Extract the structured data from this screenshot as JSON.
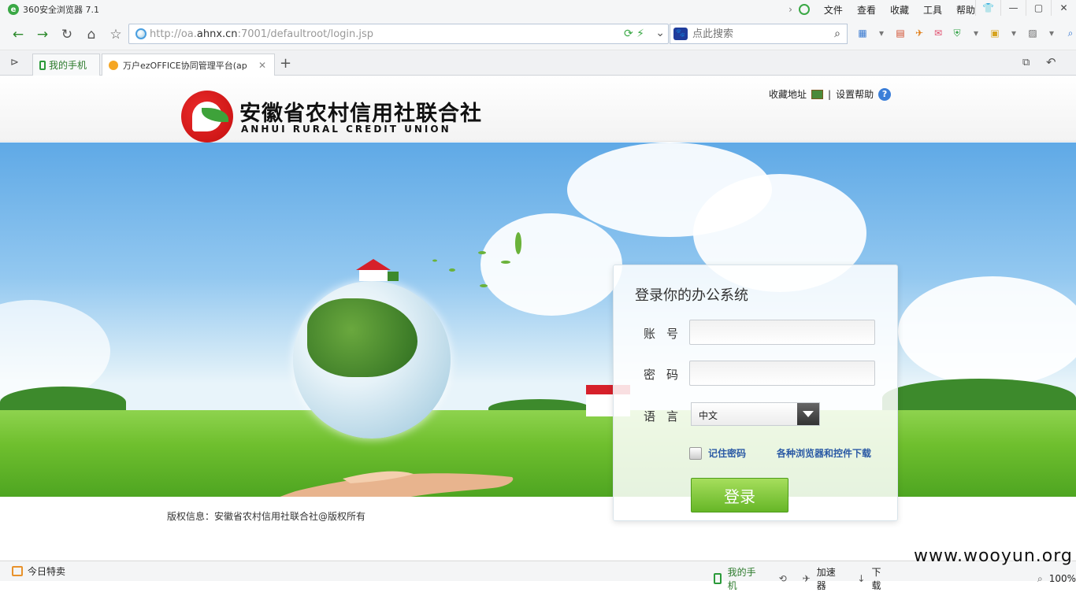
{
  "browser": {
    "title": "360安全浏览器 7.1",
    "menu": [
      "文件",
      "查看",
      "收藏",
      "工具",
      "帮助"
    ],
    "url_prefix": "http://oa.",
    "url_domain": "ahnx.cn",
    "url_rest": ":7001/defaultroot/login.jsp",
    "search_placeholder": "点此搜索",
    "tabs": [
      {
        "label": "我的手机"
      },
      {
        "label": "万户ezOFFICE协同管理平台(ap"
      }
    ]
  },
  "page": {
    "org_name_cn": "安徽省农村信用社联合社",
    "org_name_en": "ANHUI RURAL CREDIT UNION",
    "top_links": {
      "favorite": "收藏地址",
      "separator": "|",
      "help": "设置帮助"
    },
    "login": {
      "heading": "登录你的办公系统",
      "account_label": "账号",
      "password_label": "密码",
      "language_label": "语言",
      "language_value": "中文",
      "remember_label": "记住密码",
      "download_link": "各种浏览器和控件下载",
      "submit_label": "登录"
    },
    "copyright": "版权信息：安徽省农村信用社联合社@版权所有"
  },
  "statusbar": {
    "today_deals": "今日特卖",
    "my_phone": "我的手机",
    "accelerator": "加速器",
    "download": "下载",
    "zoom": "100%"
  },
  "watermark": "www.wooyun.org"
}
